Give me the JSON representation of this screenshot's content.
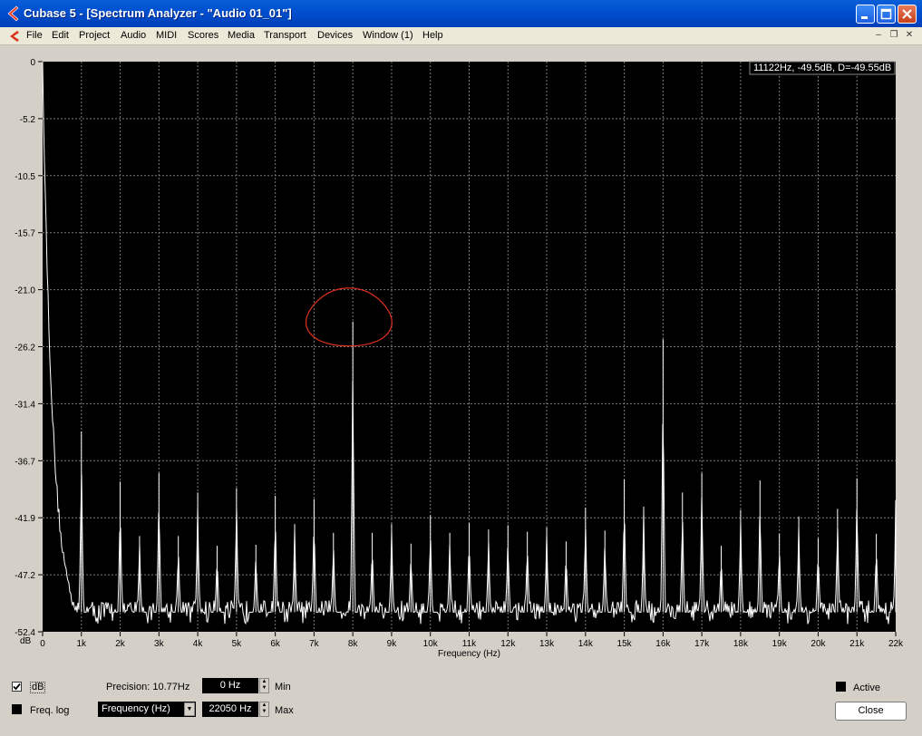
{
  "window": {
    "title": "Cubase 5 - [Spectrum Analyzer - \"Audio 01_01\"]"
  },
  "menu": [
    "File",
    "Edit",
    "Project",
    "Audio",
    "MIDI",
    "Scores",
    "Media",
    "Transport",
    "Devices",
    "Window (1)",
    "Help"
  ],
  "readout": "11122Hz, -49.5dB, D=-49.55dB",
  "y_axis": {
    "unit": "dB",
    "ticks": [
      "0",
      "-5.2",
      "-10.5",
      "-15.7",
      "-21.0",
      "-26.2",
      "-31.4",
      "-36.7",
      "-41.9",
      "-47.2",
      "-52.4"
    ]
  },
  "x_axis": {
    "label": "Frequency (Hz)",
    "ticks": [
      "0",
      "1k",
      "2k",
      "3k",
      "4k",
      "5k",
      "6k",
      "7k",
      "8k",
      "9k",
      "10k",
      "11k",
      "12k",
      "13k",
      "14k",
      "15k",
      "16k",
      "17k",
      "18k",
      "19k",
      "20k",
      "21k",
      "22k"
    ]
  },
  "chart_data": {
    "type": "line",
    "xlabel": "Frequency (Hz)",
    "ylabel": "dB",
    "xlim": [
      0,
      22050
    ],
    "ylim": [
      -52.4,
      0
    ],
    "grid": true,
    "background": "#000000",
    "line_color": "#ffffff",
    "grid_color": "#7a7a7a",
    "noise_floor_db": -50.6,
    "peaks": [
      {
        "x": 1000,
        "y": -34.0
      },
      {
        "x": 2000,
        "y": -38.6
      },
      {
        "x": 2500,
        "y": -43.6
      },
      {
        "x": 3000,
        "y": -37.8
      },
      {
        "x": 3500,
        "y": -43.6
      },
      {
        "x": 4000,
        "y": -39.6
      },
      {
        "x": 4500,
        "y": -44.5
      },
      {
        "x": 5000,
        "y": -39.2
      },
      {
        "x": 5500,
        "y": -44.4
      },
      {
        "x": 6000,
        "y": -39.9
      },
      {
        "x": 6500,
        "y": -42.5
      },
      {
        "x": 7000,
        "y": -40.2
      },
      {
        "x": 7500,
        "y": -43.3
      },
      {
        "x": 8000,
        "y": -23.9
      },
      {
        "x": 8500,
        "y": -43.3
      },
      {
        "x": 9000,
        "y": -42.5
      },
      {
        "x": 9500,
        "y": -44.3
      },
      {
        "x": 10000,
        "y": -41.7
      },
      {
        "x": 10500,
        "y": -43.3
      },
      {
        "x": 11000,
        "y": -42.4
      },
      {
        "x": 11500,
        "y": -43.0
      },
      {
        "x": 12000,
        "y": -42.6
      },
      {
        "x": 12500,
        "y": -43.2
      },
      {
        "x": 13000,
        "y": -42.8
      },
      {
        "x": 13500,
        "y": -44.1
      },
      {
        "x": 14000,
        "y": -41.0
      },
      {
        "x": 14500,
        "y": -43.1
      },
      {
        "x": 15000,
        "y": -38.4
      },
      {
        "x": 15500,
        "y": -40.9
      },
      {
        "x": 16000,
        "y": -25.5
      },
      {
        "x": 16500,
        "y": -39.6
      },
      {
        "x": 17000,
        "y": -37.8
      },
      {
        "x": 17500,
        "y": -44.5
      },
      {
        "x": 18000,
        "y": -41.2
      },
      {
        "x": 18500,
        "y": -38.5
      },
      {
        "x": 19000,
        "y": -43.4
      },
      {
        "x": 19500,
        "y": -41.8
      },
      {
        "x": 20000,
        "y": -43.8
      },
      {
        "x": 20500,
        "y": -41.1
      },
      {
        "x": 21000,
        "y": -38.3
      },
      {
        "x": 21500,
        "y": -43.4
      },
      {
        "x": 22000,
        "y": -40.3
      }
    ],
    "annotation": {
      "type": "circle",
      "color": "#e03020",
      "x": 7900,
      "y": -23.6
    }
  },
  "controls": {
    "db_label": "dB",
    "db_checked": true,
    "freq_log_label": "Freq. log",
    "freq_log_checked": false,
    "precision": "Precision: 10.77Hz",
    "min_value": "0 Hz",
    "min_label": "Min",
    "max_value": "22050 Hz",
    "max_label": "Max",
    "x_mode": "Frequency (Hz)",
    "active_label": "Active",
    "close_label": "Close"
  }
}
